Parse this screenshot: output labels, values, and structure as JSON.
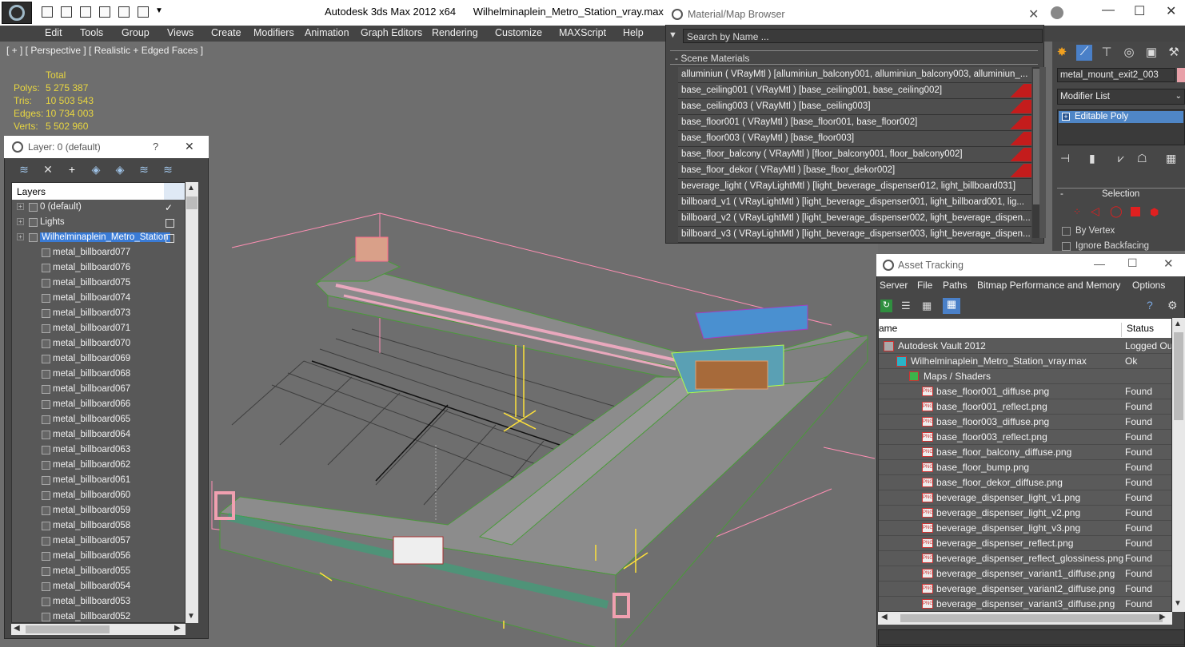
{
  "window": {
    "app_title": "Autodesk 3ds Max  2012 x64",
    "file_name": "Wilhelminaplein_Metro_Station_vray.max"
  },
  "menu": [
    "Edit",
    "Tools",
    "Group",
    "Views",
    "Create",
    "Modifiers",
    "Animation",
    "Graph Editors",
    "Rendering",
    "Customize",
    "MAXScript",
    "Help"
  ],
  "viewport": {
    "label": "[ + ] [ Perspective ] [ Realistic + Edged Faces ]",
    "stats_header": "Total",
    "stats": [
      {
        "label": "Polys:",
        "value": "5 275 387"
      },
      {
        "label": "Tris:",
        "value": "10 503 543"
      },
      {
        "label": "Edges:",
        "value": "10 734 003"
      },
      {
        "label": "Verts:",
        "value": "5 502 960"
      }
    ]
  },
  "layer_panel": {
    "title": "Layer: 0 (default)",
    "help": "?",
    "close": "✕",
    "column_header": "Layers",
    "rows": [
      {
        "label": "0 (default)",
        "indent": 20
      },
      {
        "label": "Lights",
        "indent": 20
      },
      {
        "label": "Wilhelminaplein_Metro_Station",
        "indent": 20,
        "selected": true
      },
      {
        "label": "metal_billboard077",
        "indent": 36
      },
      {
        "label": "metal_billboard076",
        "indent": 36
      },
      {
        "label": "metal_billboard075",
        "indent": 36
      },
      {
        "label": "metal_billboard074",
        "indent": 36
      },
      {
        "label": "metal_billboard073",
        "indent": 36
      },
      {
        "label": "metal_billboard071",
        "indent": 36
      },
      {
        "label": "metal_billboard070",
        "indent": 36
      },
      {
        "label": "metal_billboard069",
        "indent": 36
      },
      {
        "label": "metal_billboard068",
        "indent": 36
      },
      {
        "label": "metal_billboard067",
        "indent": 36
      },
      {
        "label": "metal_billboard066",
        "indent": 36
      },
      {
        "label": "metal_billboard065",
        "indent": 36
      },
      {
        "label": "metal_billboard064",
        "indent": 36
      },
      {
        "label": "metal_billboard063",
        "indent": 36
      },
      {
        "label": "metal_billboard062",
        "indent": 36
      },
      {
        "label": "metal_billboard061",
        "indent": 36
      },
      {
        "label": "metal_billboard060",
        "indent": 36
      },
      {
        "label": "metal_billboard059",
        "indent": 36
      },
      {
        "label": "metal_billboard058",
        "indent": 36
      },
      {
        "label": "metal_billboard057",
        "indent": 36
      },
      {
        "label": "metal_billboard056",
        "indent": 36
      },
      {
        "label": "metal_billboard055",
        "indent": 36
      },
      {
        "label": "metal_billboard054",
        "indent": 36
      },
      {
        "label": "metal_billboard053",
        "indent": 36
      },
      {
        "label": "metal_billboard052",
        "indent": 36
      }
    ]
  },
  "material_browser": {
    "title": "Material/Map Browser",
    "search_placeholder": "Search by Name ...",
    "category": "- Scene Materials",
    "rows": [
      "alluminiun  ( VRayMtl )  [alluminiun_balcony001, alluminiun_balcony003, alluminiun_...",
      "base_ceiling001  ( VRayMtl )  [base_ceiling001, base_ceiling002]",
      "base_ceiling003  ( VRayMtl )  [base_ceiling003]",
      "base_floor001  ( VRayMtl )  [base_floor001, base_floor002]",
      "base_floor003  ( VRayMtl )  [base_floor003]",
      "base_floor_balcony  ( VRayMtl )  [floor_balcony001, floor_balcony002]",
      "base_floor_dekor  ( VRayMtl )  [base_floor_dekor002]",
      "beverage_light  ( VRayLightMtl )  [light_beverage_dispenser012, light_billboard031]",
      "billboard_v1  ( VRayLightMtl )  [light_beverage_dispenser001, light_billboard001, lig...",
      "billboard_v2  ( VRayLightMtl )  [light_beverage_dispenser002, light_beverage_dispen...",
      "billboard_v3  ( VRayLightMtl )  [light_beverage_dispenser003, light_beverage_dispen..."
    ],
    "swatch_rows": [
      1,
      2,
      3,
      4,
      5,
      6
    ]
  },
  "command_panel": {
    "object_name": "metal_mount_exit2_003",
    "modifier_list": "Modifier List",
    "modifier": "Editable Poly",
    "rollout": "Selection",
    "by_vertex": "By Vertex",
    "ignore_backfacing": "Ignore Backfacing"
  },
  "asset_tracking": {
    "title": "Asset Tracking",
    "menu": [
      "Server",
      "File",
      "Paths",
      "Bitmap Performance and Memory",
      "Options"
    ],
    "col_name": "ame",
    "col_status": "Status",
    "rows": [
      {
        "name": "Autodesk Vault 2012",
        "status": "Logged Ou",
        "indent": 24,
        "kind": "vault"
      },
      {
        "name": "Wilhelminaplein_Metro_Station_vray.max",
        "status": "Ok",
        "indent": 40,
        "kind": "max"
      },
      {
        "name": "Maps / Shaders",
        "status": "",
        "indent": 56,
        "kind": "folder"
      },
      {
        "name": "base_floor001_diffuse.png",
        "status": "Found",
        "indent": 72,
        "kind": "png"
      },
      {
        "name": "base_floor001_reflect.png",
        "status": "Found",
        "indent": 72,
        "kind": "png"
      },
      {
        "name": "base_floor003_diffuse.png",
        "status": "Found",
        "indent": 72,
        "kind": "png"
      },
      {
        "name": "base_floor003_reflect.png",
        "status": "Found",
        "indent": 72,
        "kind": "png"
      },
      {
        "name": "base_floor_balcony_diffuse.png",
        "status": "Found",
        "indent": 72,
        "kind": "png"
      },
      {
        "name": "base_floor_bump.png",
        "status": "Found",
        "indent": 72,
        "kind": "png"
      },
      {
        "name": "base_floor_dekor_diffuse.png",
        "status": "Found",
        "indent": 72,
        "kind": "png"
      },
      {
        "name": "beverage_dispenser_light_v1.png",
        "status": "Found",
        "indent": 72,
        "kind": "png"
      },
      {
        "name": "beverage_dispenser_light_v2.png",
        "status": "Found",
        "indent": 72,
        "kind": "png"
      },
      {
        "name": "beverage_dispenser_light_v3.png",
        "status": "Found",
        "indent": 72,
        "kind": "png"
      },
      {
        "name": "beverage_dispenser_reflect.png",
        "status": "Found",
        "indent": 72,
        "kind": "png"
      },
      {
        "name": "beverage_dispenser_reflect_glossiness.png",
        "status": "Found",
        "indent": 72,
        "kind": "png"
      },
      {
        "name": "beverage_dispenser_variant1_diffuse.png",
        "status": "Found",
        "indent": 72,
        "kind": "png"
      },
      {
        "name": "beverage_dispenser_variant2_diffuse.png",
        "status": "Found",
        "indent": 72,
        "kind": "png"
      },
      {
        "name": "beverage_dispenser_variant3_diffuse.png",
        "status": "Found",
        "indent": 72,
        "kind": "png"
      }
    ]
  },
  "colors": {
    "stat_text": "#e8d640",
    "selection_blue": "#3a7bd5",
    "swatch_red": "#c41c1c",
    "wire_pink": "#ff8fb4",
    "wire_green": "#4a9a3a"
  }
}
